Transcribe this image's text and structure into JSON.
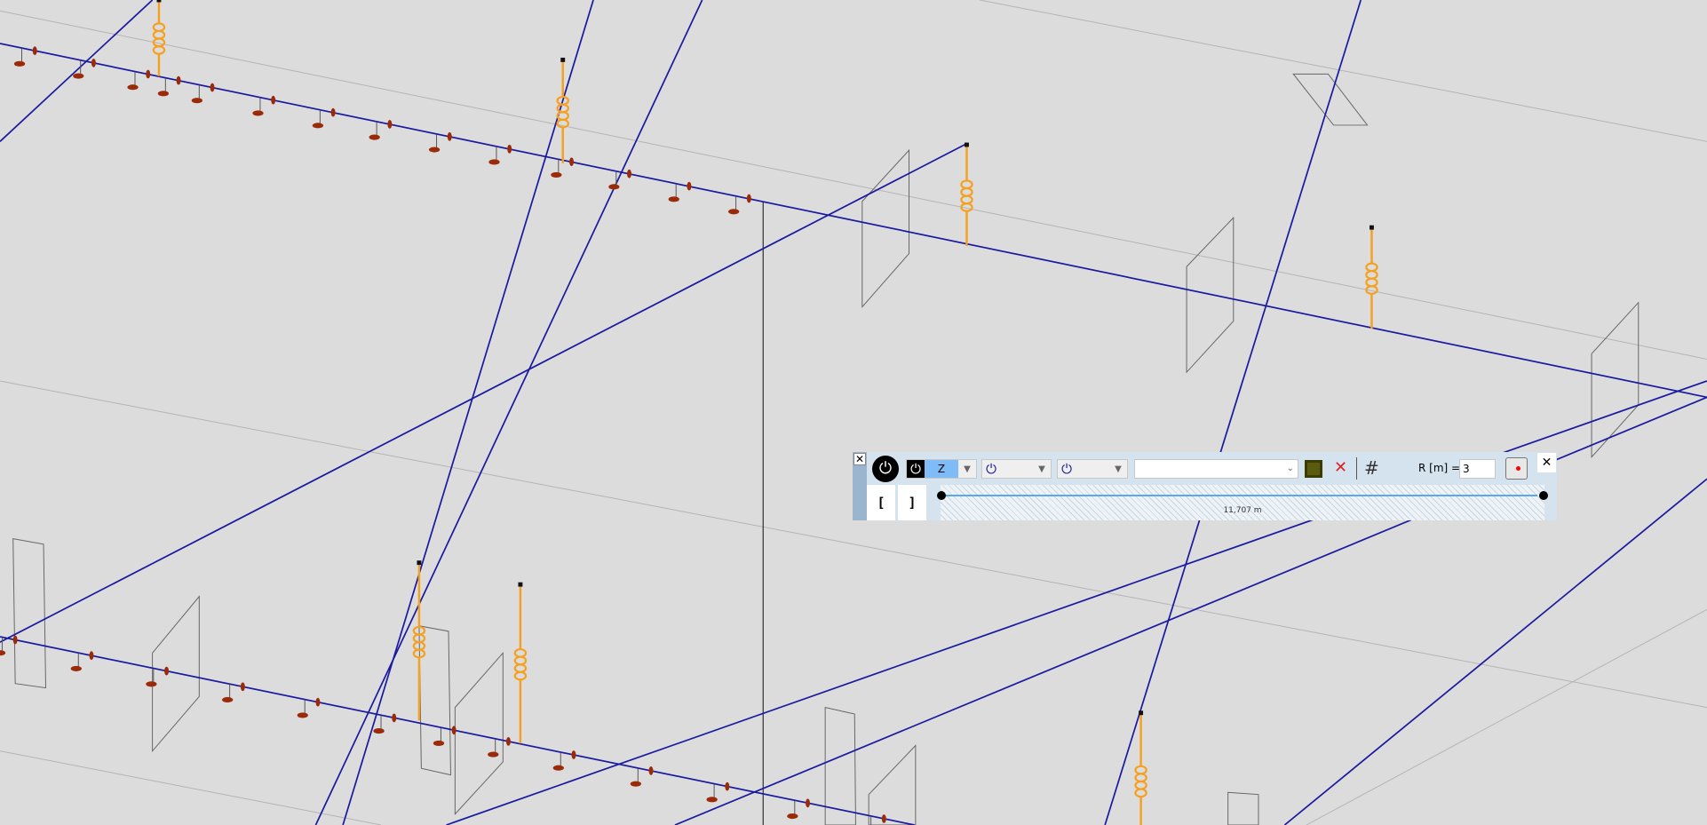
{
  "toolbar": {
    "close_left": "✕",
    "power_main": "⏻",
    "axis_combo": {
      "icon": "⏻",
      "value": "Z"
    },
    "combo2": {
      "icon": "⏻",
      "value": ""
    },
    "combo3": {
      "icon": "⏻",
      "value": ""
    },
    "text_combo": {
      "value": ""
    },
    "radius_label": "R [m] =",
    "radius_value": "3",
    "close_right": "✕",
    "bracket_open": "[",
    "bracket_close": "]",
    "slider_label": "11,707 m"
  },
  "colors": {
    "beam": "#1a1aa0",
    "spring": "#f5a020",
    "support": "#9a2a08",
    "panel": "#d5e3ef"
  }
}
